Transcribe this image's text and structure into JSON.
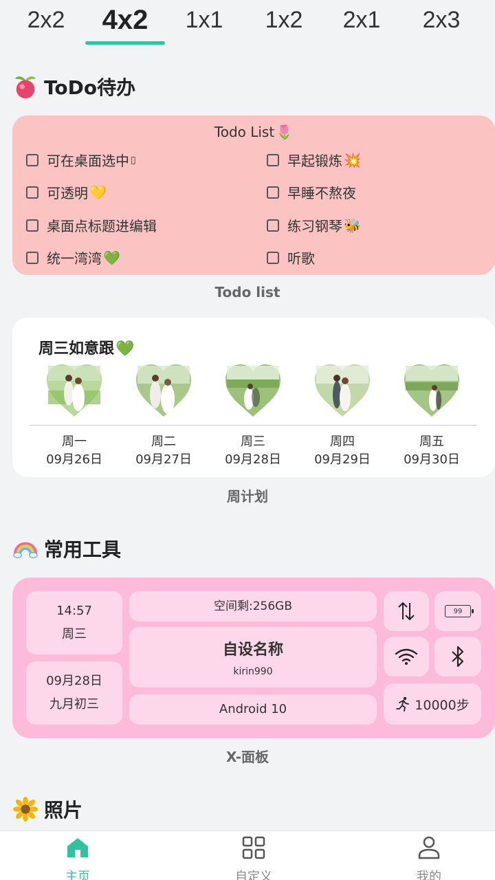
{
  "size_tabs": [
    {
      "label": "2x2",
      "active": false
    },
    {
      "label": "4x2",
      "active": true
    },
    {
      "label": "1x1",
      "active": false
    },
    {
      "label": "1x2",
      "active": false
    },
    {
      "label": "2x1",
      "active": false
    },
    {
      "label": "2x3",
      "active": false
    }
  ],
  "sections": {
    "todo": {
      "title": "ToDo待办",
      "icon": "peach-icon"
    },
    "tools": {
      "title": "常用工具",
      "icon": "rainbow-icon"
    },
    "photos": {
      "title": "照片",
      "icon": "sunflower-icon"
    }
  },
  "todo_widget": {
    "title": "Todo List",
    "title_emoji": "🌷",
    "items_left": [
      {
        "text": "可在桌面选中",
        "emoji": "▯"
      },
      {
        "text": "可透明",
        "emoji": "💛"
      },
      {
        "text": "桌面点标题进编辑",
        "emoji": ""
      },
      {
        "text": "统一湾湾",
        "emoji": "💚"
      }
    ],
    "items_right": [
      {
        "text": "早起锻炼",
        "emoji": "💥"
      },
      {
        "text": "早睡不熬夜",
        "emoji": ""
      },
      {
        "text": "练习钢琴",
        "emoji": "🐝"
      },
      {
        "text": "听歌",
        "emoji": ""
      }
    ],
    "caption": "Todo list"
  },
  "week_widget": {
    "title": "周三如意跟",
    "title_emoji": "💚",
    "days": [
      {
        "day": "周一",
        "date": "09月26日"
      },
      {
        "day": "周二",
        "date": "09月27日"
      },
      {
        "day": "周三",
        "date": "09月28日"
      },
      {
        "day": "周四",
        "date": "09月29日"
      },
      {
        "day": "周五",
        "date": "09月30日"
      }
    ],
    "caption": "周计划"
  },
  "tools_panel": {
    "time": "14:57",
    "weekday": "周三",
    "date": "09月28日",
    "lunar": "九月初三",
    "storage": "空间剩:256GB",
    "custom_name": "自设名称",
    "chip": "kirin990",
    "android": "Android 10",
    "battery": "99",
    "steps": "10000步",
    "caption": "X-面板",
    "colors": {
      "panel": "#fdbbd9",
      "tile": "#fdd7ea"
    }
  },
  "bottom_nav": [
    {
      "label": "主页",
      "icon": "home-icon",
      "active": true
    },
    {
      "label": "自定义",
      "icon": "grid-icon",
      "active": false
    },
    {
      "label": "我的",
      "icon": "person-icon",
      "active": false
    }
  ],
  "colors": {
    "accent": "#2ec4a0",
    "todo_bg": "#fbc4c2",
    "page_bg": "#f2f3f5"
  }
}
